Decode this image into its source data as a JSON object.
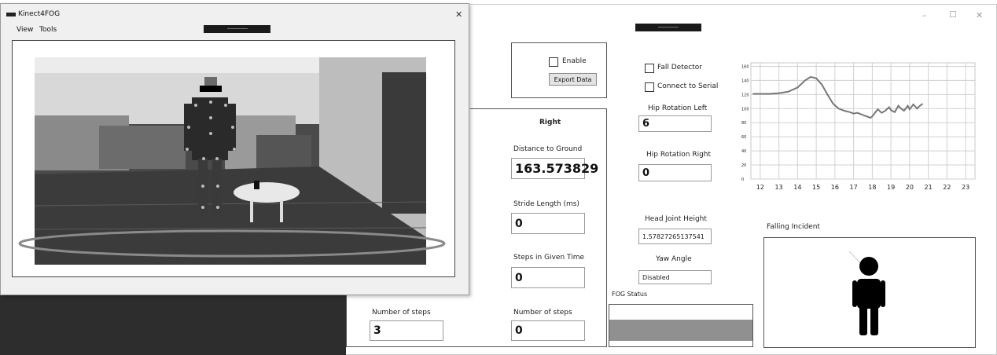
{
  "front_window": {
    "title": "Kinect4FOG",
    "close_glyph": "✕",
    "menu": [
      "View",
      "Tools"
    ]
  },
  "main_window": {
    "controls": [
      "–",
      "☐",
      "✕"
    ]
  },
  "enable_label": "Enable",
  "export_button": "Export Data",
  "right_panel": {
    "heading": "Right",
    "distance_label": "Distance to Ground",
    "distance_value": "163.573829",
    "stride_label": "Stride Length (ms)",
    "stride_value": "0",
    "steps_time_label": "Steps in Given Time",
    "steps_time_value": "0",
    "num_steps_label": "Number of steps",
    "num_steps_value": "0"
  },
  "left_panel": {
    "num_steps_label": "Number of steps",
    "num_steps_value": "3"
  },
  "middle": {
    "fall_detector_label": "Fall Detector",
    "connect_serial_label": "Connect to Serial",
    "hip_left_label": "Hip Rotation Left",
    "hip_left_value": "6",
    "hip_right_label": "Hip Rotation Right",
    "hip_right_value": "0",
    "head_height_label": "Head Joint Height",
    "head_height_value": "1.57827265137541",
    "yaw_label": "Yaw Angle",
    "yaw_value": "Disabled",
    "fog_status_label": "FOG Status"
  },
  "falling_incident_label": "Falling Incident",
  "chart_data": {
    "type": "line",
    "xlim": [
      11.5,
      23.5
    ],
    "ylim": [
      0,
      165
    ],
    "x_ticks": [
      "12",
      "13",
      "14",
      "15",
      "16",
      "17",
      "18",
      "19",
      "20",
      "21",
      "22",
      "23"
    ],
    "y_ticks": [
      "0",
      "20",
      "40",
      "60",
      "80",
      "100",
      "120",
      "140",
      "160"
    ],
    "grid": true,
    "series": [
      {
        "x": [
          11.6,
          12.0,
          12.5,
          13.0,
          13.5,
          14.0,
          14.4,
          14.7,
          15.0,
          15.3,
          15.6,
          15.9,
          16.2,
          16.5,
          16.8,
          17.0,
          17.2,
          17.4,
          17.6,
          17.8,
          17.9,
          18.0,
          18.2,
          18.3,
          18.5,
          18.7,
          18.9,
          19.0,
          19.2,
          19.4,
          19.5,
          19.7,
          19.9,
          20.0,
          20.2,
          20.4,
          20.5,
          20.7
        ],
        "y": [
          121,
          121,
          121,
          122,
          124,
          130,
          140,
          145,
          143,
          134,
          120,
          107,
          100,
          97,
          95,
          93,
          94,
          92,
          90,
          88,
          87,
          89,
          96,
          99,
          94,
          97,
          102,
          98,
          95,
          104,
          101,
          97,
          104,
          99,
          106,
          100,
          103,
          107
        ]
      }
    ]
  }
}
